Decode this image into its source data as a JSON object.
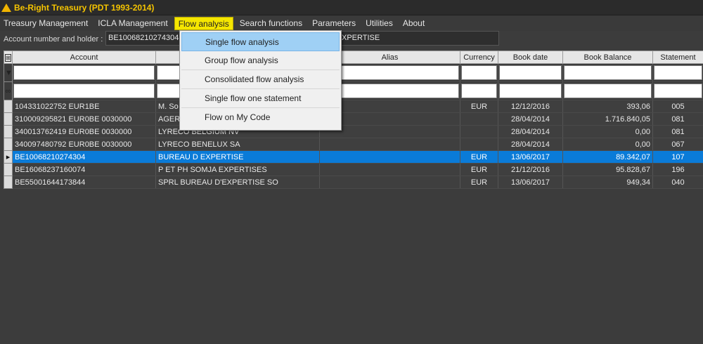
{
  "app": {
    "title": "Be-Right Treasury  (PDT 1993-2014)"
  },
  "menu": [
    {
      "label": "Treasury Management",
      "active": false
    },
    {
      "label": "ICLA Management",
      "active": false
    },
    {
      "label": "Flow analysis",
      "active": true
    },
    {
      "label": "Search functions",
      "active": false
    },
    {
      "label": "Parameters",
      "active": false
    },
    {
      "label": "Utilities",
      "active": false
    },
    {
      "label": "About",
      "active": false
    }
  ],
  "account_bar": {
    "label": "Account number and holder :",
    "value": "BE10068210274304",
    "holder_suffix": "XPERTISE"
  },
  "dropdown": [
    {
      "label": "Single flow analysis",
      "highlighted": true
    },
    {
      "label": "Group flow analysis",
      "highlighted": false
    },
    {
      "label": "Consolidated flow analysis",
      "highlighted": false
    },
    {
      "label": "Single flow one statement",
      "highlighted": false
    },
    {
      "label": "Flow on My Code",
      "highlighted": false
    }
  ],
  "table": {
    "columns": [
      "Account",
      "",
      "",
      "Alias",
      "Currency",
      "Book date",
      "Book Balance",
      "Statement"
    ],
    "rows": [
      {
        "account": "104331022752 EUR1BE",
        "holder": "M. So",
        "alias": "",
        "currency": "EUR",
        "date": "12/12/2016",
        "balance": "393,06",
        "statement": "005",
        "selected": false
      },
      {
        "account": "310009295821 EUR0BE   0030000",
        "holder": "AGER",
        "alias": "",
        "currency": "",
        "date": "28/04/2014",
        "balance": "1.716.840,05",
        "statement": "081",
        "selected": false
      },
      {
        "account": "340013762419 EUR0BE   0030000",
        "holder": "LYRECO BELGIUM NV",
        "alias": "",
        "currency": "",
        "date": "28/04/2014",
        "balance": "0,00",
        "statement": "081",
        "selected": false
      },
      {
        "account": "340097480792 EUR0BE   0030000",
        "holder": "LYRECO BENELUX SA",
        "alias": "",
        "currency": "",
        "date": "28/04/2014",
        "balance": "0,00",
        "statement": "067",
        "selected": false
      },
      {
        "account": "BE10068210274304",
        "holder": "BUREAU D EXPERTISE",
        "alias": "",
        "currency": "EUR",
        "date": "13/06/2017",
        "balance": "89.342,07",
        "statement": "107",
        "selected": true
      },
      {
        "account": "BE16068237160074",
        "holder": "P ET PH SOMJA EXPERTISES",
        "alias": "",
        "currency": "EUR",
        "date": "21/12/2016",
        "balance": "95.828,67",
        "statement": "196",
        "selected": false
      },
      {
        "account": "BE55001644173844",
        "holder": "SPRL BUREAU D'EXPERTISE SO",
        "alias": "",
        "currency": "EUR",
        "date": "13/06/2017",
        "balance": "949,34",
        "statement": "040",
        "selected": false
      }
    ]
  },
  "colors": {
    "title": "#f5c400",
    "menu_active": "#f5e600",
    "selection": "#0a7bd8",
    "dropdown_highlight": "#9fd0f5"
  }
}
